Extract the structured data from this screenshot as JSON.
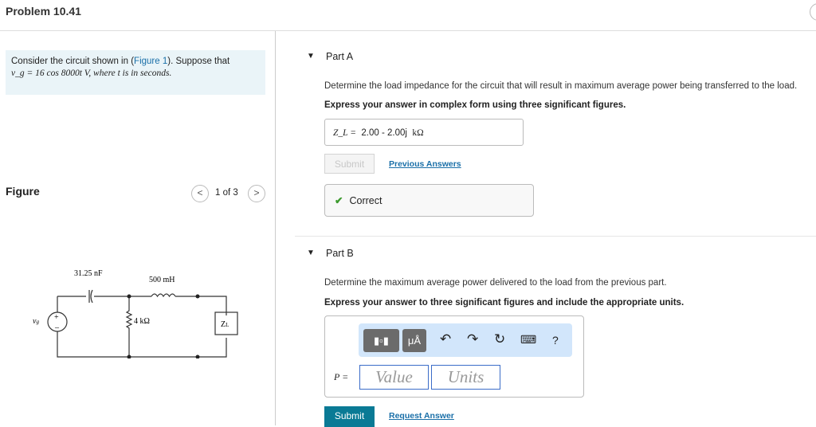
{
  "title": "Problem 10.41",
  "intro": {
    "pre": "Consider the circuit shown in (",
    "link": "Figure 1",
    "post": "). Suppose that",
    "eq": "v_g = 16 cos 8000t V, where t is in seconds."
  },
  "figure": {
    "label": "Figure",
    "page": "1 of 3",
    "circuit": {
      "capacitor": "31.25 nF",
      "inductor": "500 mH",
      "resistor": "4 kΩ",
      "load": "Z_L",
      "source": "v_g"
    }
  },
  "partA": {
    "label": "Part A",
    "question": "Determine the load impedance for the circuit that will result in maximum average power being transferred to the load.",
    "instruction": "Express your answer in complex form using three significant figures.",
    "var": "Z_L =",
    "answer": "2.00 - 2.00j",
    "unit": "kΩ",
    "submit": "Submit",
    "prev": "Previous Answers",
    "feedback": "Correct"
  },
  "partB": {
    "label": "Part B",
    "question": "Determine the maximum average power delivered to the load from the previous part.",
    "instruction": "Express your answer to three significant figures and include the appropriate units.",
    "var": "P =",
    "value_placeholder": "Value",
    "units_placeholder": "Units",
    "submit": "Submit",
    "request": "Request Answer",
    "units_btn": "μÅ",
    "help": "?"
  }
}
